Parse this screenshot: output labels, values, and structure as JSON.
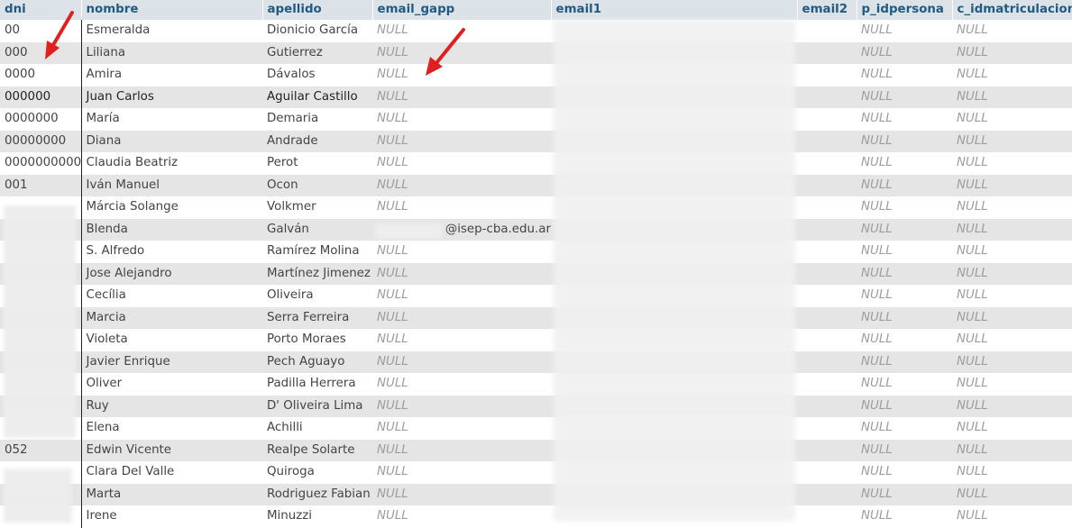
{
  "columns": {
    "dni": "dni",
    "nombre": "nombre",
    "apellido": "apellido",
    "email_gapp": "email_gapp",
    "email1": "email1",
    "email2": "email2",
    "p_idpersona": "p_idpersona",
    "c_idmatriculacion": "c_idmatriculacion"
  },
  "null_text": "NULL",
  "rows": [
    {
      "dni": "00",
      "nombre": "Esmeralda",
      "apellido": "Dionicio García",
      "email_gapp": "NULL"
    },
    {
      "dni": "000",
      "nombre": "Liliana",
      "apellido": "Gutierrez",
      "email_gapp": "NULL"
    },
    {
      "dni": "0000",
      "nombre": "Amira",
      "apellido": "Dávalos",
      "email_gapp": "NULL"
    },
    {
      "dni": "000000",
      "nombre": "Juan Carlos",
      "apellido": "Aguilar Castillo",
      "email_gapp": "NULL"
    },
    {
      "dni": "0000000",
      "nombre": "María",
      "apellido": "Demaria",
      "email_gapp": "NULL"
    },
    {
      "dni": "00000000",
      "nombre": "Diana",
      "apellido": "Andrade",
      "email_gapp": "NULL"
    },
    {
      "dni": "0000000000",
      "nombre": "Claudia Beatriz",
      "apellido": "Perot",
      "email_gapp": "NULL"
    },
    {
      "dni": "001",
      "nombre": "Iván Manuel",
      "apellido": "Ocon",
      "email_gapp": "NULL"
    },
    {
      "dni": "",
      "nombre": "Márcia Solange",
      "apellido": "Volkmer",
      "email_gapp": "NULL"
    },
    {
      "dni": "",
      "nombre": "Blenda",
      "apellido": "Galván",
      "email_gapp": "@isep-cba.edu.ar"
    },
    {
      "dni": "",
      "nombre": "S. Alfredo",
      "apellido": "Ramírez Molina",
      "email_gapp": "NULL"
    },
    {
      "dni": "",
      "nombre": "Jose Alejandro",
      "apellido": "Martínez Jimenez",
      "email_gapp": "NULL"
    },
    {
      "dni": "",
      "nombre": "Cecília",
      "apellido": "Oliveira",
      "email_gapp": "NULL"
    },
    {
      "dni": "",
      "nombre": "Marcia",
      "apellido": "Serra Ferreira",
      "email_gapp": "NULL"
    },
    {
      "dni": "",
      "nombre": "Violeta",
      "apellido": "Porto Moraes",
      "email_gapp": "NULL"
    },
    {
      "dni": "",
      "nombre": "Javier Enrique",
      "apellido": "Pech Aguayo",
      "email_gapp": "NULL"
    },
    {
      "dni": "",
      "nombre": "Oliver",
      "apellido": "Padilla Herrera",
      "email_gapp": "NULL"
    },
    {
      "dni": "",
      "nombre": "Ruy",
      "apellido": "D' Oliveira Lima",
      "email_gapp": "NULL"
    },
    {
      "dni": "",
      "nombre": "Elena",
      "apellido": "Achilli",
      "email_gapp": "NULL"
    },
    {
      "dni": "052",
      "nombre": "Edwin Vicente",
      "apellido": "Realpe Solarte",
      "email_gapp": "NULL"
    },
    {
      "dni": "",
      "nombre": "Clara Del Valle",
      "apellido": "Quiroga",
      "email_gapp": "NULL"
    },
    {
      "dni": "",
      "nombre": "Marta",
      "apellido": "Rodriguez Fabian",
      "email_gapp": "NULL"
    },
    {
      "dni": "",
      "nombre": "Irene",
      "apellido": "Minuzzi",
      "email_gapp": "NULL"
    }
  ],
  "annotation_color": "#e02020"
}
